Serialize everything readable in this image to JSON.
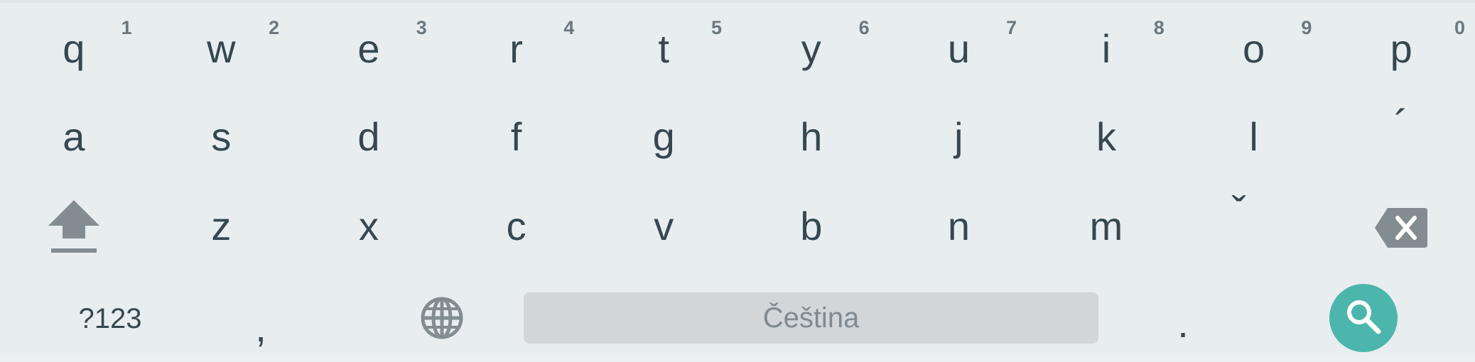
{
  "keyboard": {
    "row1": [
      {
        "key": "q",
        "hint": "1"
      },
      {
        "key": "w",
        "hint": "2"
      },
      {
        "key": "e",
        "hint": "3"
      },
      {
        "key": "r",
        "hint": "4"
      },
      {
        "key": "t",
        "hint": "5"
      },
      {
        "key": "y",
        "hint": "6"
      },
      {
        "key": "u",
        "hint": "7"
      },
      {
        "key": "i",
        "hint": "8"
      },
      {
        "key": "o",
        "hint": "9"
      },
      {
        "key": "p",
        "hint": "0"
      }
    ],
    "row2": [
      "a",
      "s",
      "d",
      "f",
      "g",
      "h",
      "j",
      "k",
      "l",
      "´"
    ],
    "row3": [
      "z",
      "x",
      "c",
      "v",
      "b",
      "n",
      "m",
      "ˇ"
    ],
    "bottom": {
      "symbols_label": "?123",
      "comma_label": ",",
      "space_label": "Čeština",
      "period_label": "."
    },
    "icons": {
      "shift": "shift-icon",
      "backspace": "backspace-icon",
      "globe": "globe-icon",
      "search": "search-icon"
    },
    "colors": {
      "background": "#e8edf0",
      "key_text": "#37474f",
      "hint_text": "#6b787f",
      "icon": "#838d91",
      "spacebar": "#d2d6d9",
      "action_button": "#4db6ac"
    }
  }
}
